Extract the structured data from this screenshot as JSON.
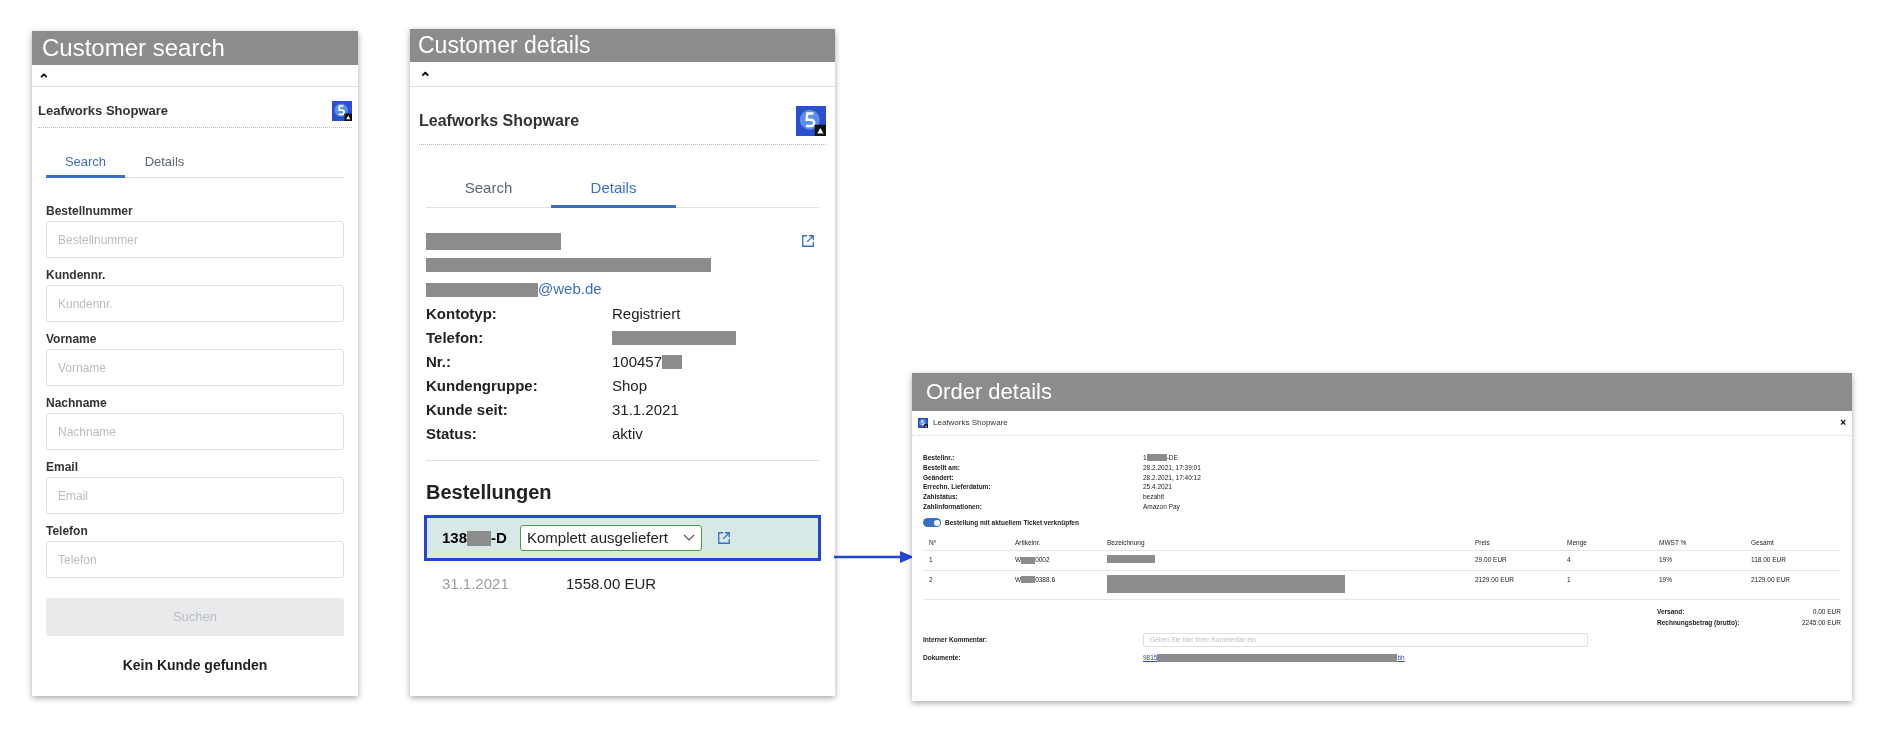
{
  "customer_search": {
    "caption": "Customer search",
    "collapse": "⌃",
    "app_title": "Leafworks Shopware",
    "tabs": [
      {
        "label": "Search",
        "selected": true
      },
      {
        "label": "Details",
        "selected": false
      }
    ],
    "fields": [
      {
        "label": "Bestellnummer",
        "placeholder": "Bestellnummer"
      },
      {
        "label": "Kundennr.",
        "placeholder": "Kundennr."
      },
      {
        "label": "Vorname",
        "placeholder": "Vorname"
      },
      {
        "label": "Nachname",
        "placeholder": "Nachname"
      },
      {
        "label": "Email",
        "placeholder": "Email"
      },
      {
        "label": "Telefon",
        "placeholder": "Telefon"
      }
    ],
    "search_button": {
      "label": "Suchen",
      "disabled": true
    },
    "message": "Kein Kunde gefunden"
  },
  "customer_details": {
    "caption": "Customer details",
    "collapse": "⌃",
    "app_title": "Leafworks Shopware",
    "tabs": [
      {
        "label": "Search",
        "selected": false
      },
      {
        "label": "Details",
        "selected": true
      }
    ],
    "name": [
      {
        "kind": "redacted"
      }
    ],
    "address": [
      {
        "kind": "redacted"
      }
    ],
    "email": [
      {
        "kind": "redacted"
      },
      {
        "kind": "text",
        "text": "@web.de"
      }
    ],
    "properties": [
      {
        "label": "Kontotyp:",
        "value": [
          {
            "kind": "text",
            "text": "Registriert"
          }
        ]
      },
      {
        "label": "Telefon:",
        "value": [
          {
            "kind": "redacted"
          }
        ]
      },
      {
        "label": "Nr.:",
        "value": [
          {
            "kind": "text",
            "text": "100457"
          },
          {
            "kind": "redacted"
          }
        ]
      },
      {
        "label": "Kundengruppe:",
        "value": [
          {
            "kind": "text",
            "text": "Shop"
          }
        ]
      },
      {
        "label": "Kunde seit:",
        "value": [
          {
            "kind": "text",
            "text": "31.1.2021"
          }
        ]
      },
      {
        "label": "Status:",
        "value": [
          {
            "kind": "text",
            "text": "aktiv"
          }
        ]
      }
    ],
    "orders_heading": "Bestellungen",
    "orders": [
      {
        "number": [
          {
            "kind": "text",
            "text": "138"
          },
          {
            "kind": "redacted"
          },
          {
            "kind": "text",
            "text": "-D"
          }
        ],
        "status": "Komplett ausgeliefert",
        "selected": true,
        "date": "31.1.2021",
        "total": "1558.00 EUR"
      }
    ]
  },
  "order_details": {
    "caption": "Order details",
    "app_title": "Leafworks Shopware",
    "close": "×",
    "info": [
      {
        "label": "Bestellnr.:",
        "value": [
          {
            "kind": "text",
            "text": "1"
          },
          {
            "kind": "redacted"
          },
          {
            "kind": "text",
            "text": "-DE"
          }
        ]
      },
      {
        "label": "Bestellt am:",
        "value": [
          {
            "kind": "text",
            "text": "28.2.2021, 17:39:01"
          }
        ]
      },
      {
        "label": "Geändert:",
        "value": [
          {
            "kind": "text",
            "text": "28.2.2021, 17:40:12"
          }
        ]
      },
      {
        "label": "Errechn. Lieferdatum:",
        "value": [
          {
            "kind": "text",
            "text": "25.4.2021"
          }
        ]
      },
      {
        "label": "Zahlstatus:",
        "value": [
          {
            "kind": "text",
            "text": "bezahlt"
          }
        ]
      },
      {
        "label": "Zahlinformationen:",
        "value": [
          {
            "kind": "text",
            "text": "Amazon Pay"
          }
        ]
      }
    ],
    "toggle": {
      "label": "Bestellung mit aktuellem Ticket verknüpfen",
      "on": true
    },
    "columns": [
      "Nº",
      "Artikelnr.",
      "Bezeichnung",
      "Preis",
      "Menge",
      "MWST %",
      "Gesamt"
    ],
    "rows": [
      {
        "cells": [
          [
            {
              "kind": "text",
              "text": "1"
            }
          ],
          [
            {
              "kind": "text",
              "text": "W"
            },
            {
              "kind": "redacted"
            },
            {
              "kind": "text",
              "text": "0002"
            }
          ],
          [
            {
              "kind": "redacted"
            }
          ],
          [
            {
              "kind": "text",
              "text": "29.00 EUR"
            }
          ],
          [
            {
              "kind": "text",
              "text": "4"
            }
          ],
          [
            {
              "kind": "text",
              "text": "19%"
            }
          ],
          [
            {
              "kind": "text",
              "text": "118.00 EUR"
            }
          ]
        ]
      },
      {
        "cells": [
          [
            {
              "kind": "text",
              "text": "2"
            }
          ],
          [
            {
              "kind": "text",
              "text": "W"
            },
            {
              "kind": "redacted"
            },
            {
              "kind": "text",
              "text": "0388.6"
            }
          ],
          [
            {
              "kind": "redacted"
            }
          ],
          [
            {
              "kind": "text",
              "text": "2129.00 EUR"
            }
          ],
          [
            {
              "kind": "text",
              "text": "1"
            }
          ],
          [
            {
              "kind": "text",
              "text": "19%"
            }
          ],
          [
            {
              "kind": "text",
              "text": "2129.00 EUR"
            }
          ]
        ]
      }
    ],
    "totals": [
      {
        "label": "Versand:",
        "value": "0.00 EUR"
      },
      {
        "label": "Rechnungsbetrag (brutto):",
        "value": "2245.00 EUR"
      }
    ],
    "comment": {
      "label": "Interner Kommentar:",
      "placeholder": "Geben Sie hier Ihren Kommentar ein"
    },
    "documents": {
      "label": "Dokumente:",
      "link": [
        {
          "kind": "text",
          "text": "9815"
        },
        {
          "kind": "redacted"
        },
        {
          "kind": "text",
          "text": "bh"
        }
      ]
    }
  }
}
